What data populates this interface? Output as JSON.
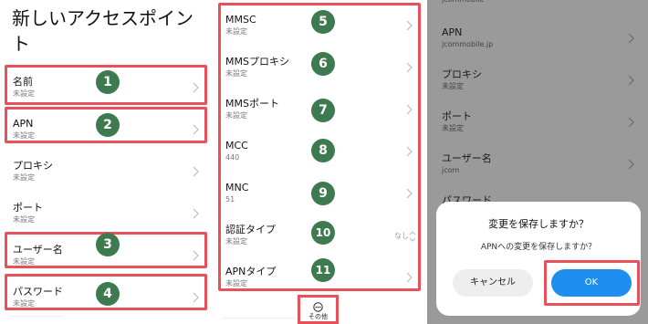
{
  "screen1": {
    "title": "新しいアクセスポイント",
    "items": [
      {
        "label": "名前",
        "value": "未設定",
        "badge": "1"
      },
      {
        "label": "APN",
        "value": "未設定",
        "badge": "2"
      },
      {
        "label": "プロキシ",
        "value": "未設定"
      },
      {
        "label": "ポート",
        "value": "未設定"
      },
      {
        "label": "ユーザー名",
        "value": "未設定",
        "badge": "3"
      },
      {
        "label": "パスワード",
        "value": "未設定",
        "badge": "4"
      }
    ]
  },
  "screen2": {
    "items": [
      {
        "label": "MMSC",
        "value": "未設定",
        "badge": "5"
      },
      {
        "label": "MMSプロキシ",
        "value": "未設定",
        "badge": "6"
      },
      {
        "label": "MMSポート",
        "value": "未設定",
        "badge": "7"
      },
      {
        "label": "MCC",
        "value": "440",
        "badge": "8"
      },
      {
        "label": "MNC",
        "value": "51",
        "badge": "9"
      },
      {
        "label": "認証タイプ",
        "value": "未設定",
        "badge": "10",
        "extra": "なし"
      },
      {
        "label": "APNタイプ",
        "value": "未設定",
        "badge": "11"
      }
    ],
    "more_label": "その他"
  },
  "screen3": {
    "top_value": "jcommobile",
    "items": [
      {
        "label": "APN",
        "value": "jcommobile.jp"
      },
      {
        "label": "プロキシ",
        "value": "未設定"
      },
      {
        "label": "ポート",
        "value": "未設定"
      },
      {
        "label": "ユーザー名",
        "value": "jcom"
      },
      {
        "label": "パスワード",
        "value": ""
      }
    ],
    "dialog": {
      "title": "変更を保存しますか？",
      "message": "APNへの変更を保存しますか？",
      "cancel_label": "キャンセル",
      "ok_label": "OK"
    }
  },
  "colors": {
    "highlight": "#e8505a",
    "badge": "#3d7a50",
    "ok_button": "#1e8ef0"
  }
}
